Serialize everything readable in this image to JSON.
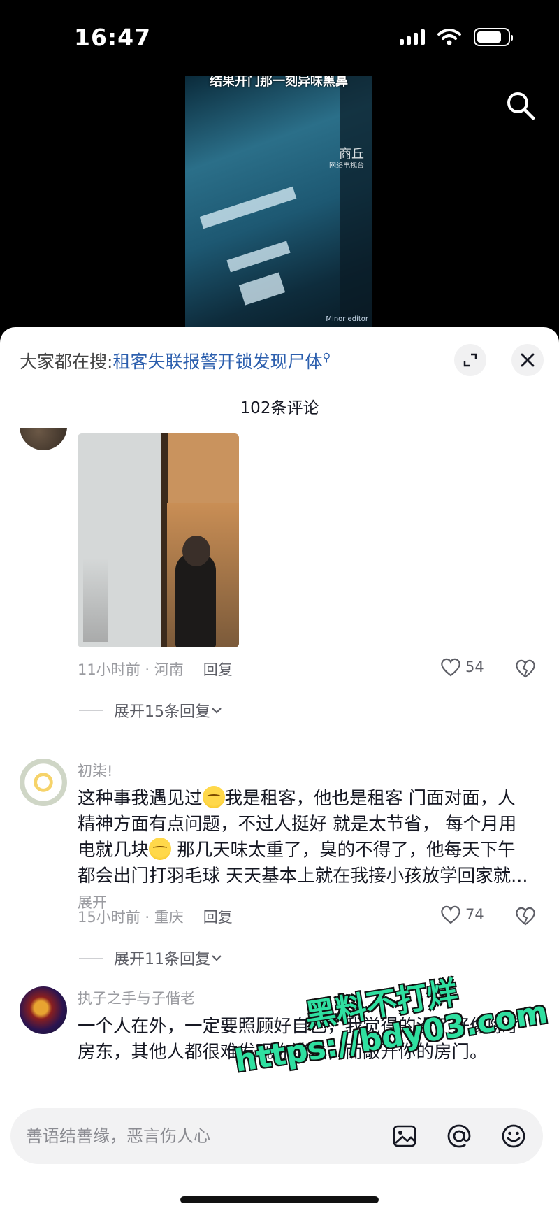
{
  "status_bar": {
    "time": "16:47"
  },
  "video": {
    "caption": "结果开门那一刻异味黑鼻",
    "logo": "商丘",
    "logo_sub": "网络电视台",
    "editor": "Minor editor"
  },
  "sheet": {
    "hot_search_prefix": "大家都在搜:",
    "hot_search_keyword": "租客失联报警开锁发现尸体",
    "comment_count": "102条评论"
  },
  "comments": [
    {
      "has_photo": true,
      "time_location": "11小时前 · 河南",
      "reply_label": "回复",
      "likes": "54",
      "expand_replies": "展开15条回复"
    },
    {
      "username": "初柒!",
      "text_parts": [
        "这种事我遇见过",
        "我是租客，他也是租客  门面对面，人精神方面有点问题，不过人挺好  就是太节省，   每个月用电就几块",
        "  那几天味太重了，臭的不得了，他每天下午都会出门打羽毛球  天天基本上就在我接小孩放学回家就..."
      ],
      "more_label": "展开",
      "time_location": "15小时前 · 重庆",
      "reply_label": "回复",
      "likes": "74",
      "expand_replies": "展开11条回复"
    },
    {
      "username": "执子之手与子偕老",
      "text": "一个人在外，一定要照顾好自己，我觉得的没了好像除了房东，其他人都很难发现你消失，而敲开你的房门。"
    }
  ],
  "watermark": {
    "line1": "黑料不打烊",
    "line2": "https://bdy03.com"
  },
  "input": {
    "placeholder": "善语结善缘，恶言伤人心"
  },
  "icons": [
    "search-icon",
    "expand-icon",
    "close-icon",
    "heart-icon",
    "dislike-icon",
    "image-icon",
    "at-icon",
    "emoji-icon",
    "chevron-down-icon"
  ]
}
